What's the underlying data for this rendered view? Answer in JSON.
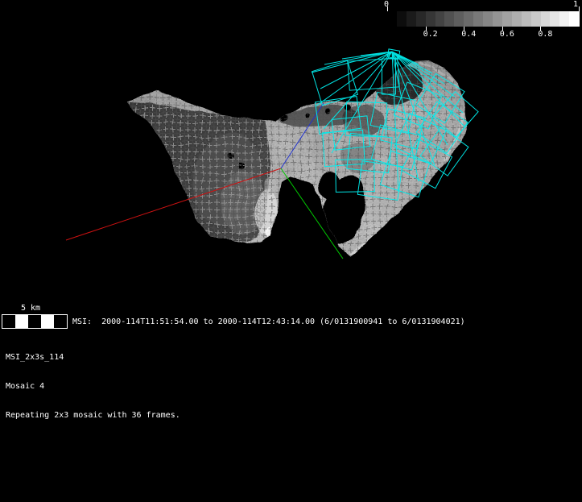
{
  "colorbar": {
    "min_label": "0",
    "max_label": "1",
    "tick_labels": [
      "0.2",
      "0.4",
      "0.6",
      "0.8"
    ],
    "tick_values": [
      0.2,
      0.4,
      0.6,
      0.8
    ],
    "steps": 20,
    "start_color": "#000000",
    "end_color": "#ffffff"
  },
  "scalebar": {
    "label": "5 km"
  },
  "status_line": "MSI:  2000-114T11:51:54.00 to 2000-114T12:43:14.00 (6/0131900941 to 6/0131904021)",
  "info": {
    "sequence_id": "MSI_2x3s_114",
    "mosaic_label": "Mosaic 4",
    "description": "Repeating 2x3 mosaic with 36 frames."
  },
  "scene": {
    "frame_count": 36,
    "footprint_color": "#00eeee",
    "x_axis_color": "#cc1111",
    "y_axis_color": "#00cc00",
    "z_axis_color": "#2233cc"
  }
}
